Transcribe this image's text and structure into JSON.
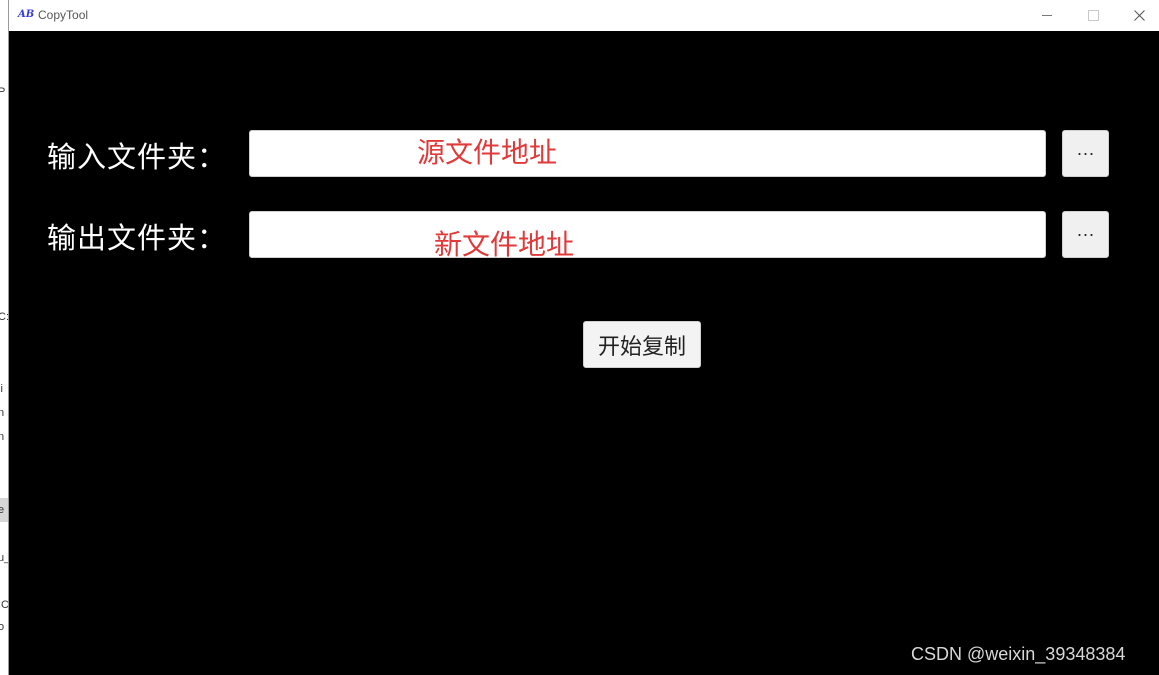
{
  "window": {
    "title": "CopyTool",
    "app_icon": "app-logo-icon",
    "close_symbol": "✕"
  },
  "form": {
    "input_label": "输入文件夹：",
    "output_label": "输出文件夹：",
    "input_annotation": "源文件地址",
    "output_annotation": "新文件地址",
    "input_value": "",
    "output_value": "",
    "browse_label": "···",
    "start_button": "开始复制"
  },
  "annotation_color": "#e03a3a",
  "watermark": "CSDN @weixin_39348384",
  "background_fragments": [
    "P",
    "C:",
    "li",
    "n",
    "n",
    "e",
    "u_",
    ":C",
    "o",
    "l"
  ]
}
